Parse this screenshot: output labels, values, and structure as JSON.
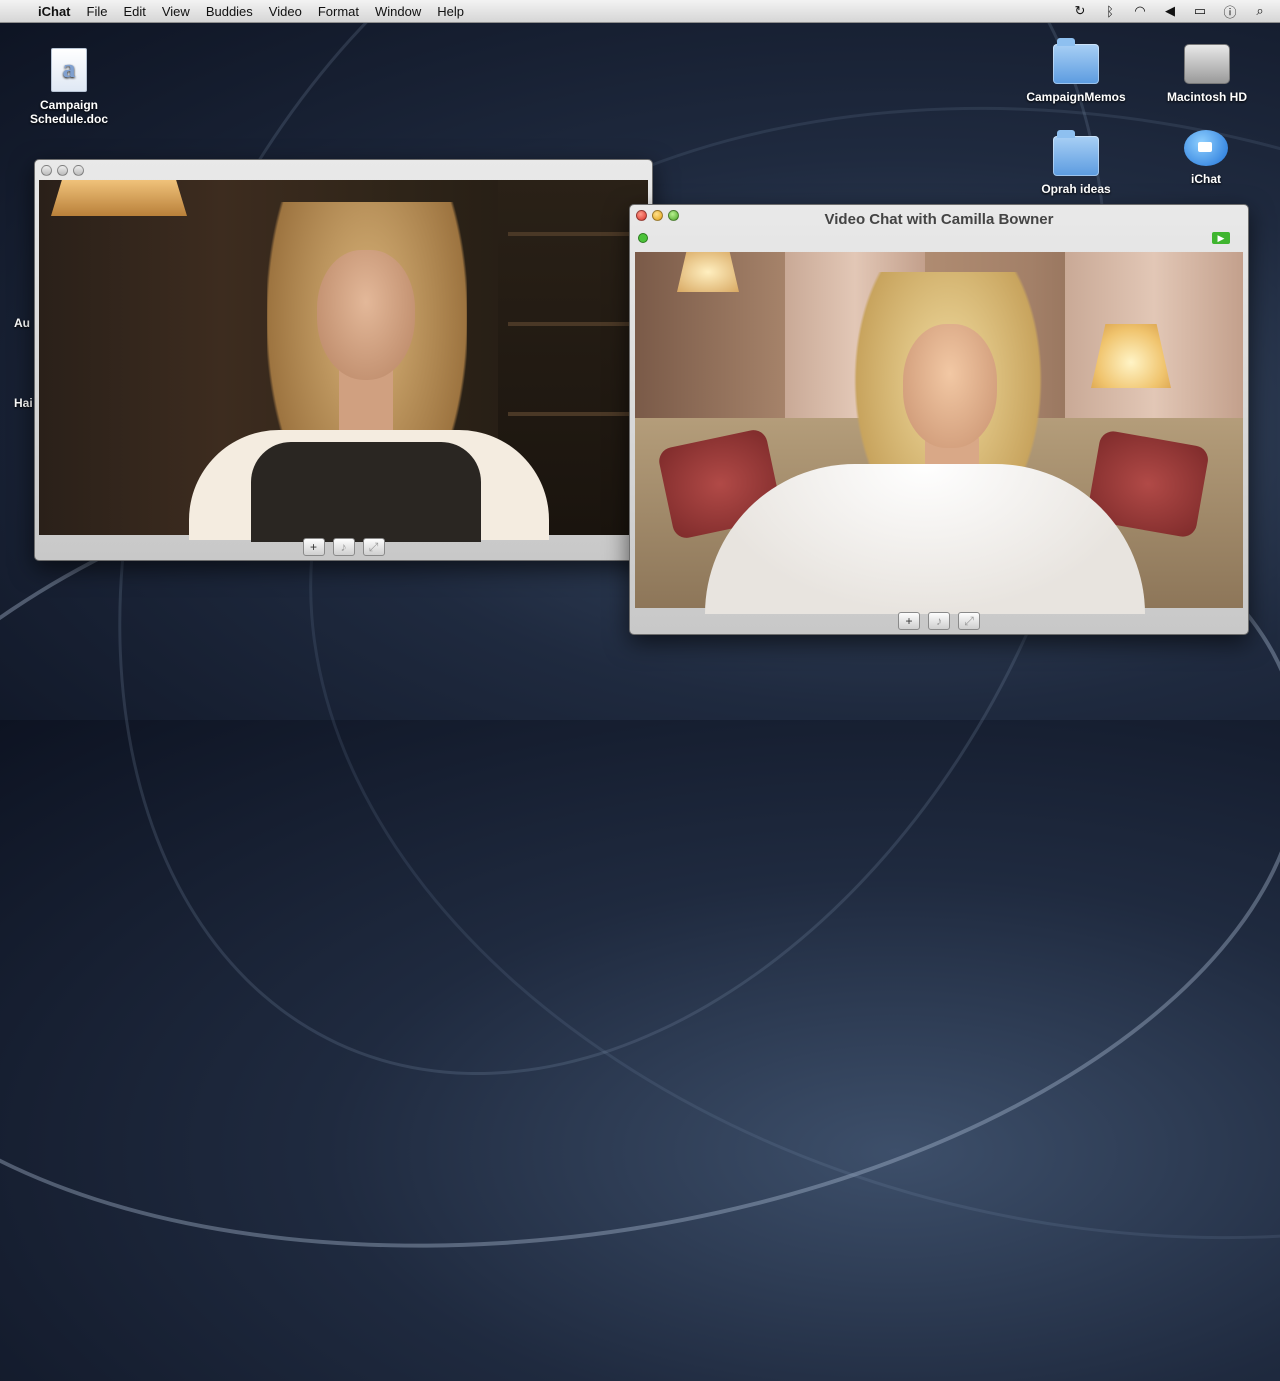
{
  "menubar": {
    "apple": "",
    "items": [
      "iChat",
      "File",
      "Edit",
      "View",
      "Buddies",
      "Video",
      "Format",
      "Window",
      "Help"
    ],
    "status_icons": [
      "time-machine-icon",
      "bluetooth-icon",
      "wifi-icon",
      "volume-icon",
      "battery-icon",
      "accessibility-icon",
      "spotlight-icon"
    ]
  },
  "desktop": {
    "campaign_doc": "Campaign Schedule.doc",
    "campaign_memos": "CampaignMemos",
    "macintosh_hd": "Macintosh HD",
    "oprah_ideas": "Oprah ideas",
    "ichat": "iChat",
    "partial_labels": [
      "Au",
      "Hai"
    ]
  },
  "windows": {
    "left": {
      "title": "",
      "controls": [
        "+",
        "mic",
        "fullscreen"
      ]
    },
    "right": {
      "title": "Video Chat with Camilla Bowner",
      "controls": [
        "+",
        "mic",
        "fullscreen"
      ]
    }
  }
}
